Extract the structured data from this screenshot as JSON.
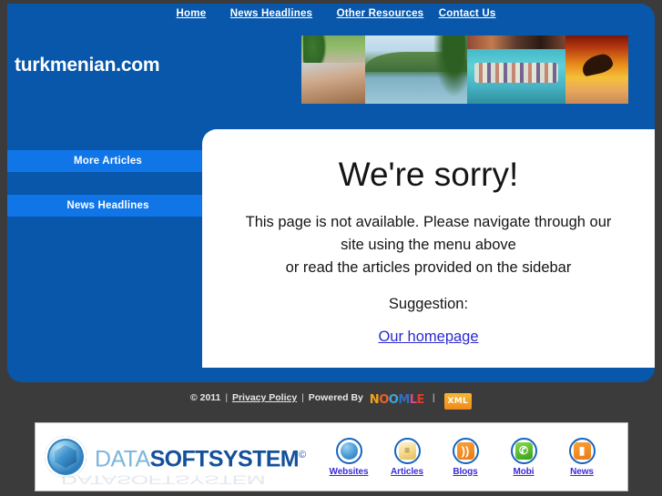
{
  "site": {
    "title": "turkmenian.com",
    "panel_color": "#0857ab",
    "accent_color": "#1076e8",
    "page_background": "#3b3b3b"
  },
  "topnav": {
    "items": [
      {
        "label": "Home",
        "name": "nav-home"
      },
      {
        "label": "News Headlines",
        "name": "nav-news-headlines"
      },
      {
        "label": "Other Resources",
        "name": "nav-other-resources"
      },
      {
        "label": "Contact Us",
        "name": "nav-contact-us"
      }
    ]
  },
  "banner": {
    "images": [
      {
        "name": "photo-palm-beach-walkway",
        "alt": "palm tree beach walkway"
      },
      {
        "name": "photo-tropical-lagoon",
        "alt": "tropical lagoon with mountain"
      },
      {
        "name": "photo-water-party",
        "alt": "people on water raft party"
      },
      {
        "name": "photo-paraglider-sunset",
        "alt": "paraglider at sunset"
      }
    ]
  },
  "sidebar": {
    "items": [
      {
        "label": "More Articles",
        "name": "sidebar-item-more-articles"
      },
      {
        "label": "News Headlines",
        "name": "sidebar-item-news-headlines"
      }
    ]
  },
  "main": {
    "heading": "We're sorry!",
    "body_line1": "This page is not available. Please navigate through our",
    "body_line2": "site using the menu above",
    "body_line3": "or read the articles provided on the sidebar",
    "suggestion_label": "Suggestion:",
    "homepage_link": "Our homepage",
    "link_color": "#2a2ad0"
  },
  "footer": {
    "copyright": "© 2011",
    "privacy_policy": "Privacy Policy",
    "powered_by": "Powered By",
    "separator": "|",
    "noomle_letters": [
      "N",
      "O",
      "O",
      "M",
      "L",
      "E"
    ],
    "noomle_name": "NOOMLE",
    "xml_badge": "XML"
  },
  "bottom_banner": {
    "brand_light": "DATA",
    "brand_bold": "SOFTSYSTEM",
    "brand_mark": "©",
    "logo_name": "datasoftsystem-logo",
    "icons": [
      {
        "label": "Websites",
        "name": "websites-icon",
        "glyph": "⊕"
      },
      {
        "label": "Articles",
        "name": "articles-icon",
        "glyph": "≡"
      },
      {
        "label": "Blogs",
        "name": "blogs-icon",
        "glyph": "◔"
      },
      {
        "label": "Mobi",
        "name": "mobi-icon",
        "glyph": "✆"
      },
      {
        "label": "News",
        "name": "news-icon",
        "glyph": "▐"
      }
    ]
  }
}
